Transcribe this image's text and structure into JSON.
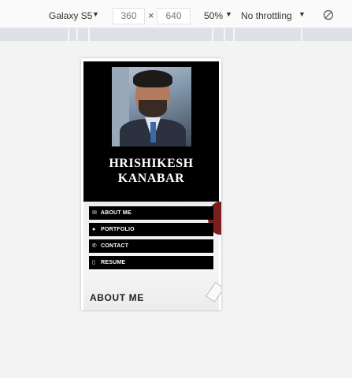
{
  "toolbar": {
    "device": "Galaxy S5",
    "width": "360",
    "times": "×",
    "height": "640",
    "zoom": "50%",
    "throttle": "No throttling",
    "caret": "▼"
  },
  "profile": {
    "name_line1": "HRISHIKESH",
    "name_line2": "KANABAR"
  },
  "nav": [
    {
      "icon": "envelope-icon",
      "glyph": "✉",
      "label": "ABOUT ME"
    },
    {
      "icon": "chat-bubble-icon",
      "glyph": "●",
      "label": "PORTFOLIO"
    },
    {
      "icon": "phone-icon",
      "glyph": "✆",
      "label": "CONTACT"
    },
    {
      "icon": "mobile-icon",
      "glyph": "▯",
      "label": "RESUME"
    }
  ],
  "section": {
    "title": "ABOUT ME"
  },
  "colors": {
    "hero_bg": "#000000",
    "button_bg": "#000000",
    "accent_red": "#7a1f1f"
  }
}
